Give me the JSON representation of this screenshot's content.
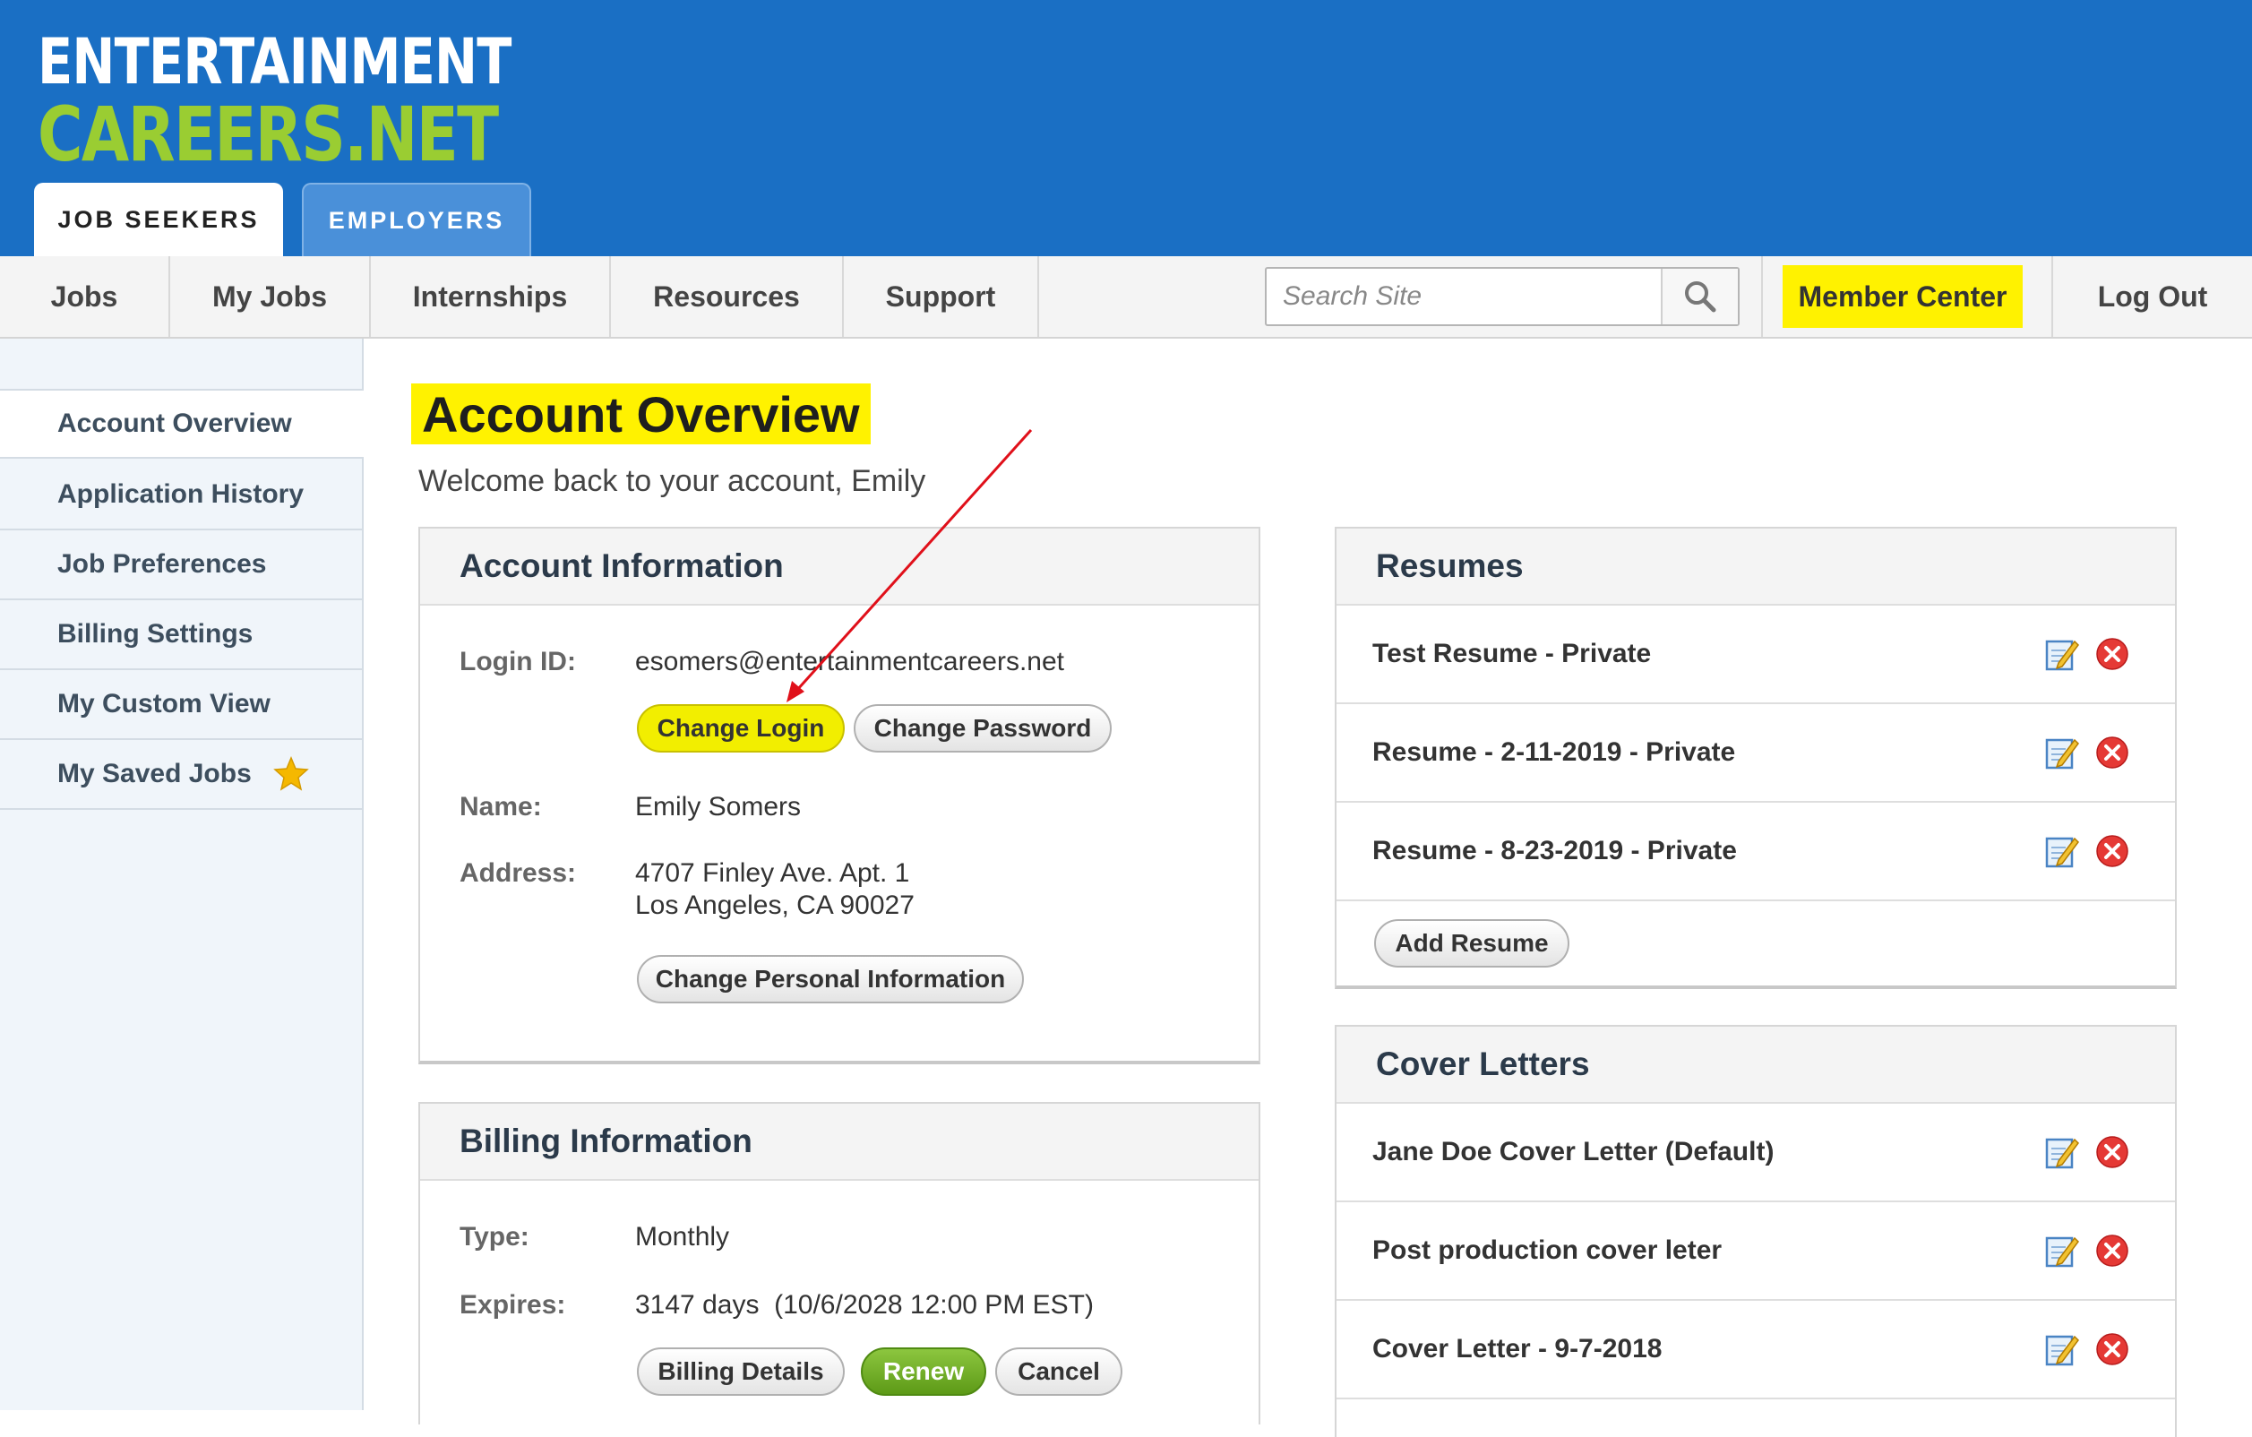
{
  "logo": {
    "line1": "ENTERTAINMENT",
    "line2": "CAREERS.NET"
  },
  "tabs": [
    {
      "label": "JOB SEEKERS"
    },
    {
      "label": "EMPLOYERS"
    }
  ],
  "nav": {
    "items": [
      "Jobs",
      "My Jobs",
      "Internships",
      "Resources",
      "Support"
    ],
    "search_placeholder": "Search Site",
    "member_center": "Member Center",
    "logout": "Log Out"
  },
  "sidebar": {
    "items": [
      {
        "label": "Account Overview"
      },
      {
        "label": "Application History"
      },
      {
        "label": "Job Preferences"
      },
      {
        "label": "Billing Settings"
      },
      {
        "label": "My Custom View"
      },
      {
        "label": "My Saved Jobs"
      }
    ]
  },
  "main": {
    "title": "Account Overview",
    "welcome": "Welcome back to your account, Emily"
  },
  "account_info": {
    "heading": "Account Information",
    "login_label": "Login ID:",
    "login_value": "esomers@entertainmentcareers.net",
    "change_login": "Change Login",
    "change_password": "Change Password",
    "name_label": "Name:",
    "name_value": "Emily Somers",
    "address_label": "Address:",
    "address_line1": "4707 Finley Ave. Apt. 1",
    "address_line2": "Los Angeles, CA 90027",
    "change_personal": "Change Personal Information"
  },
  "billing_info": {
    "heading": "Billing Information",
    "type_label": "Type:",
    "type_value": "Monthly",
    "expires_label": "Expires:",
    "expires_value": "3147 days  (10/6/2028 12:00 PM EST)",
    "billing_details": "Billing Details",
    "renew": "Renew",
    "cancel": "Cancel"
  },
  "resumes": {
    "heading": "Resumes",
    "items": [
      {
        "name": "Test Resume - Private"
      },
      {
        "name": "Resume - 2-11-2019 - Private"
      },
      {
        "name": "Resume - 8-23-2019 - Private"
      }
    ],
    "add_button": "Add Resume"
  },
  "cover_letters": {
    "heading": "Cover Letters",
    "items": [
      {
        "name": "Jane Doe Cover Letter (Default)"
      },
      {
        "name": "Post production cover leter"
      },
      {
        "name": "Cover Letter - 9-7-2018"
      }
    ]
  },
  "colors": {
    "header_blue": "#1a6fc4",
    "logo_green": "#9acd32",
    "highlight_yellow": "#fff200",
    "renew_green": "#6aa820",
    "delete_red": "#e53935",
    "annotation_arrow": "#e0101a"
  },
  "icons": {
    "search": "search-icon",
    "star": "star-icon",
    "edit": "edit-icon",
    "delete": "delete-icon"
  }
}
